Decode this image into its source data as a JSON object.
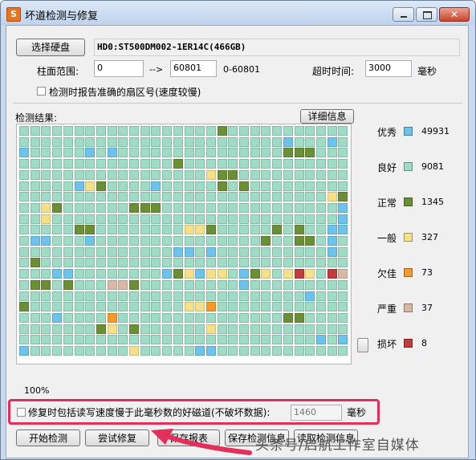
{
  "window": {
    "title": "坏道检测与修复",
    "icon_name": "app-logo-icon",
    "icon_glyph": "S"
  },
  "controls": {
    "minimize": "minimize-icon",
    "maximize": "maximize-icon",
    "close": "close-icon",
    "close_glyph": "✕"
  },
  "disk": {
    "select_button": "选择硬盘",
    "value": "HD0:ST500DM002-1ER14C(466GB)"
  },
  "range": {
    "label": "柱面范围:",
    "from": "0",
    "arrow": "-->",
    "to": "60801",
    "hint": "0-60801"
  },
  "timeout": {
    "label": "超时时间:",
    "value": "3000",
    "unit": "毫秒"
  },
  "report_accurate": {
    "label": "检测时报告准确的扇区号(速度较慢)",
    "checked": false
  },
  "results": {
    "label": "检测结果:",
    "details_button": "详细信息",
    "progress": "100%"
  },
  "legend": [
    {
      "label": "优秀",
      "color": "#6cc4ec",
      "count": "49931"
    },
    {
      "label": "良好",
      "color": "#9edcc6",
      "count": "9081"
    },
    {
      "label": "正常",
      "color": "#6b8f35",
      "count": "1345"
    },
    {
      "label": "一般",
      "color": "#f5e08a",
      "count": "327"
    },
    {
      "label": "欠佳",
      "color": "#f39a2a",
      "count": "73"
    },
    {
      "label": "严重",
      "color": "#d9b8a4",
      "count": "37"
    },
    {
      "label": "损坏",
      "color": "#c23a3a",
      "count": "8"
    }
  ],
  "repair_option": {
    "label": "修复时包括读写速度慢于此毫秒数的好磁道(不破坏数据):",
    "value": "1460",
    "unit": "毫秒",
    "checked": false
  },
  "buttons": {
    "start": "开始检测",
    "repair": "尝试修复",
    "save_report": "保存报表",
    "save_info": "保存检测信息",
    "read_info": "读取检测信息"
  },
  "watermark": "头条号/启航工作室自媒体",
  "grid_rows": [
    "GGGGGGGGGGGGGGGGGGCGGGGGGGGGGG",
    "GGGGGGGGGGGGGGGGGGGGGGGGBGGGBG",
    "BGGGGGBGBGGGGGGGGGGGGGGGCCCGGG",
    "GGGGGGGGGGGGGGCGGGGGGGGGGGGGGG",
    "GGGGGGGGGGGGGGGGGYCCGGGGGGGGGG",
    "GGGGGBYCGGGGBGGGGGCGCGGGGGGGGG",
    "GGGGGGGGGGGGGGGGGGGGGGGGGGGGYC",
    "GGYCGGGGGGCCCGGGGGGGGGGGGGGGGB",
    "GGYGGGGGGGGGGGGGGGGGGGGGGGGGGB",
    "GGGGGCCGGGGGGGGYYCGGGGGCGCGGBB",
    "GBBGGGBGGGGGGGGGGGGGGGCGGCCGBG",
    "GGGGGGGGGGGGGGBBGBGGGGGGGGGGBG",
    "GCGGGGGGGGGGGGGGGGGGGGGGGGGGGG",
    "GGGBBGGGGGGGGBCYBYYGBCYGYRYGRS",
    "GCCGCGGGMSCGGGGGGGGGBGGGGGGGGG",
    "GGGGGGGGGGGGGGGGGGGGGGGGGGBGGG",
    "CGGGGGGGGGGGGGGYYOGGGGGGGGGGGG",
    "GGGBGGGGOGGGGGGGGGGGGGGGCCGGGG",
    "GGGGGGGCYGCGGGGGGYGGGGGGGGGGGG",
    "GGGGGGGGGGGGGGGGGGGGGGGGGGGBGB",
    "BGGGGGGGGGYGGGGGBBGGGGGGGGGGGG"
  ],
  "grid_colors": {
    "G": "#9edcc6",
    "B": "#6cc4ec",
    "C": "#6b8f35",
    "Y": "#f5e08a",
    "O": "#f39a2a",
    "S": "#d9b8a4",
    "R": "#c23a3a",
    "M": "#d9b8a4"
  }
}
